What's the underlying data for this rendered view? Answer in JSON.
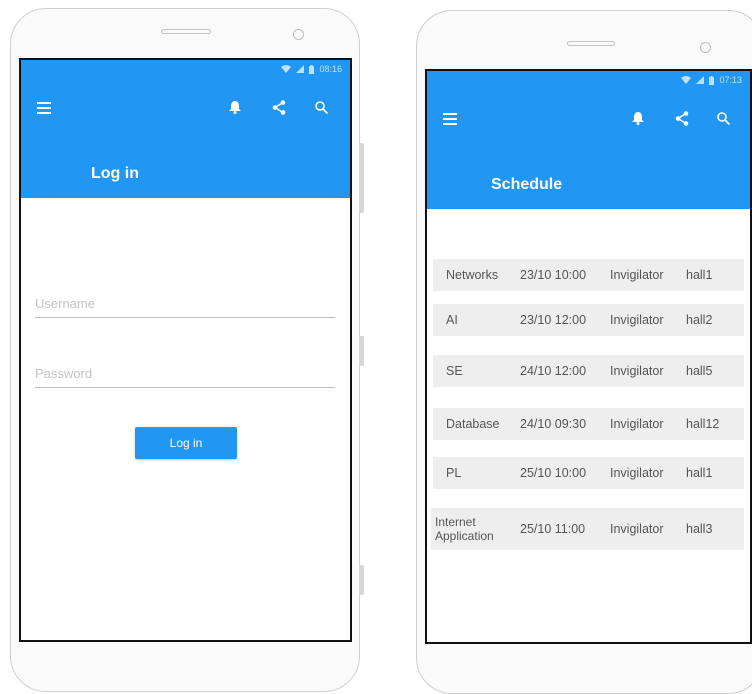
{
  "login_phone": {
    "status_time": "08:16",
    "title": "Log in",
    "username_placeholder": "Username",
    "password_placeholder": "Password",
    "login_button": "Log in"
  },
  "schedule_phone": {
    "status_time": "07:13",
    "title": "Schedule",
    "rows": [
      {
        "course": "Networks",
        "datetime": "23/10 10:00",
        "role": "Invigilator",
        "hall": "hall1"
      },
      {
        "course": "AI",
        "datetime": "23/10 12:00",
        "role": "Invigilator",
        "hall": "hall2"
      },
      {
        "course": "SE",
        "datetime": "24/10 12:00",
        "role": "Invigilator",
        "hall": "hall5"
      },
      {
        "course": "Database",
        "datetime": "24/10 09:30",
        "role": "Invigilator",
        "hall": "hall12"
      },
      {
        "course": "PL",
        "datetime": "25/10 10:00",
        "role": "Invigilator",
        "hall": "hall1"
      },
      {
        "course": "Internet Application",
        "datetime": "25/10 11:00",
        "role": "Invigilator",
        "hall": "hall3"
      }
    ]
  },
  "colors": {
    "app_bar": "#2196f3",
    "row_background": "#eeeeee"
  },
  "icons": [
    "menu-icon",
    "bell-icon",
    "share-icon",
    "search-icon",
    "wifi-icon",
    "signal-icon",
    "battery-icon"
  ]
}
